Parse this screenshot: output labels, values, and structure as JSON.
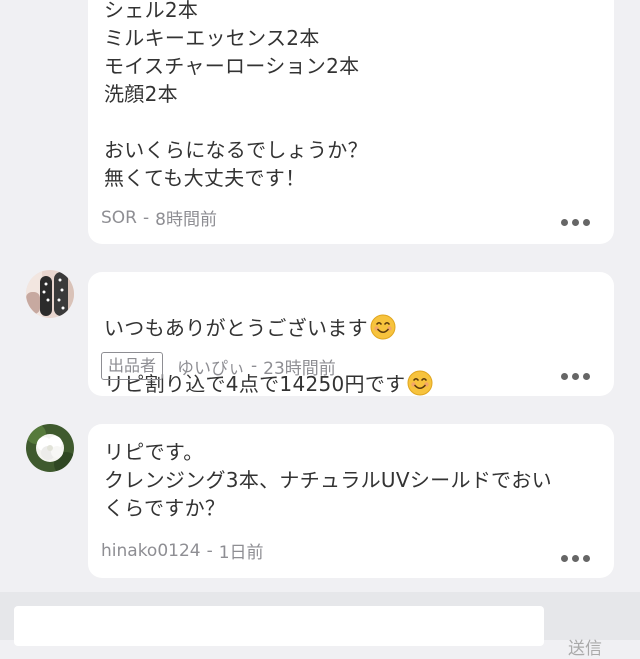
{
  "comments": [
    {
      "id": "c1",
      "lines": [
        "シェル2本",
        "ミルキーエッセンス2本",
        "モイスチャーローション2本",
        "洗顔2本",
        "",
        "おいくらになるでしょうか？",
        "無くても大丈夫です！"
      ],
      "author": "SOR",
      "time": "8時間前",
      "separator": "-"
    },
    {
      "id": "c2",
      "line1": "いつもありがとうございます",
      "line2": "リピ割り込で4点で14250円です",
      "badge": "出品者",
      "author": "ゆいぴぃ",
      "time": "23時間前",
      "separator": "-"
    },
    {
      "id": "c3",
      "text": "リピです。\nクレンジング3本、ナチュラルUVシールドでおい\nくらですか？",
      "author": "hinako0124",
      "time": "1日前",
      "separator": "-"
    }
  ],
  "footer": {
    "input_value": "",
    "send_label": "送信"
  },
  "colors": {
    "background": "#f0f0f3",
    "bubble": "#ffffff",
    "meta_text": "#8e8e93",
    "body_text": "#333333"
  },
  "icons": {
    "more": "more-horizontal-icon",
    "emoji": "smiling-face-emoji"
  }
}
